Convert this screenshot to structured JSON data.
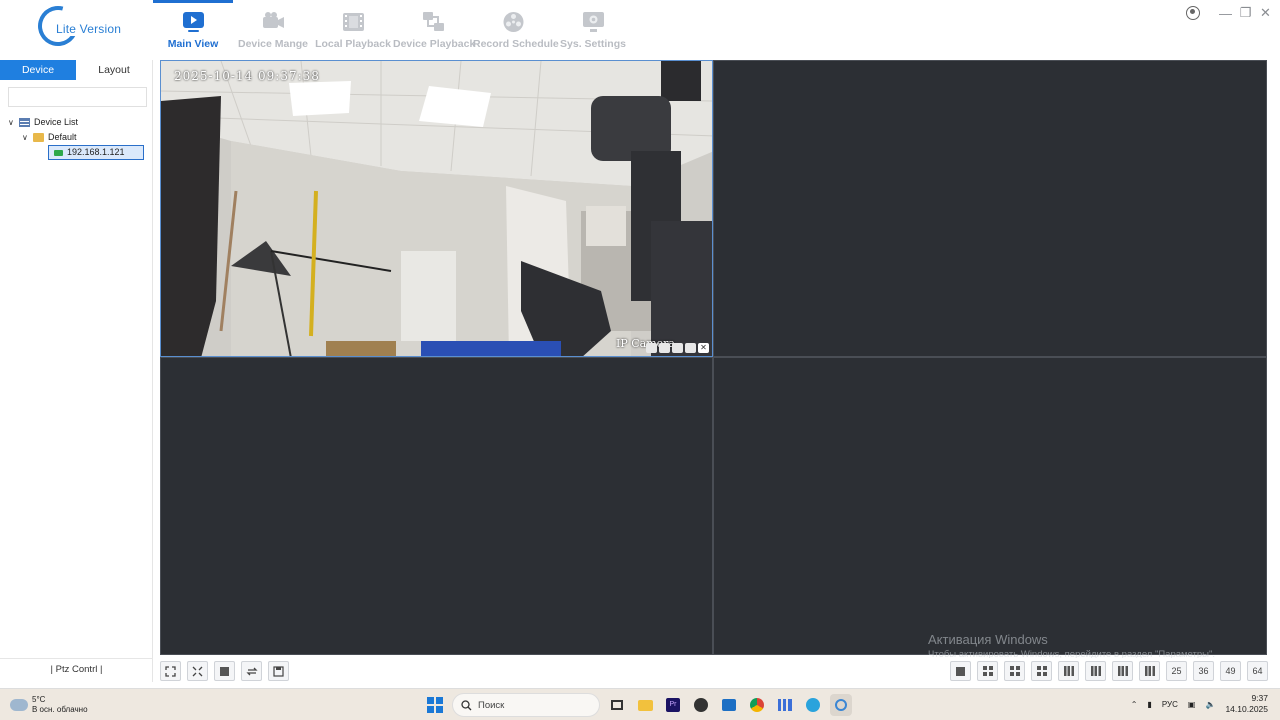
{
  "app": {
    "logo_text": "Lite Version",
    "nav": [
      {
        "label": "Main View",
        "icon": "monitor-play-icon",
        "active": true
      },
      {
        "label": "Device Mange",
        "icon": "camera-icon",
        "active": false
      },
      {
        "label": "Local Playback",
        "icon": "film-icon",
        "active": false
      },
      {
        "label": "Device Playback",
        "icon": "network-playback-icon",
        "active": false
      },
      {
        "label": "Record Schedule",
        "icon": "reel-icon",
        "active": false
      },
      {
        "label": "Sys. Settings",
        "icon": "settings-monitor-icon",
        "active": false
      }
    ],
    "accent": "#1f6fd1"
  },
  "sidebar": {
    "tabs": [
      "Device",
      "Layout"
    ],
    "active_tab": "Device",
    "search_value": "",
    "tree": {
      "root": "Device List",
      "group": "Default",
      "device": "192.168.1.121"
    },
    "ptz_label": "Ptz Contrl"
  },
  "video": {
    "cell1": {
      "timestamp": "2025-10-14 09:37:38",
      "camera_name": "IP Camera"
    },
    "watermark": {
      "title": "Активация Windows",
      "subtitle": "Чтобы активировать Windows, перейдите в раздел \"Параметры\"."
    }
  },
  "bottom_bar": {
    "layout_labels": [
      "25",
      "36",
      "49",
      "64"
    ]
  },
  "taskbar": {
    "weather_temp": "5°C",
    "weather_desc": "В осн. облачно",
    "search_placeholder": "Поиск",
    "lang": "РУС",
    "time": "9:37",
    "date": "14.10.2025"
  }
}
